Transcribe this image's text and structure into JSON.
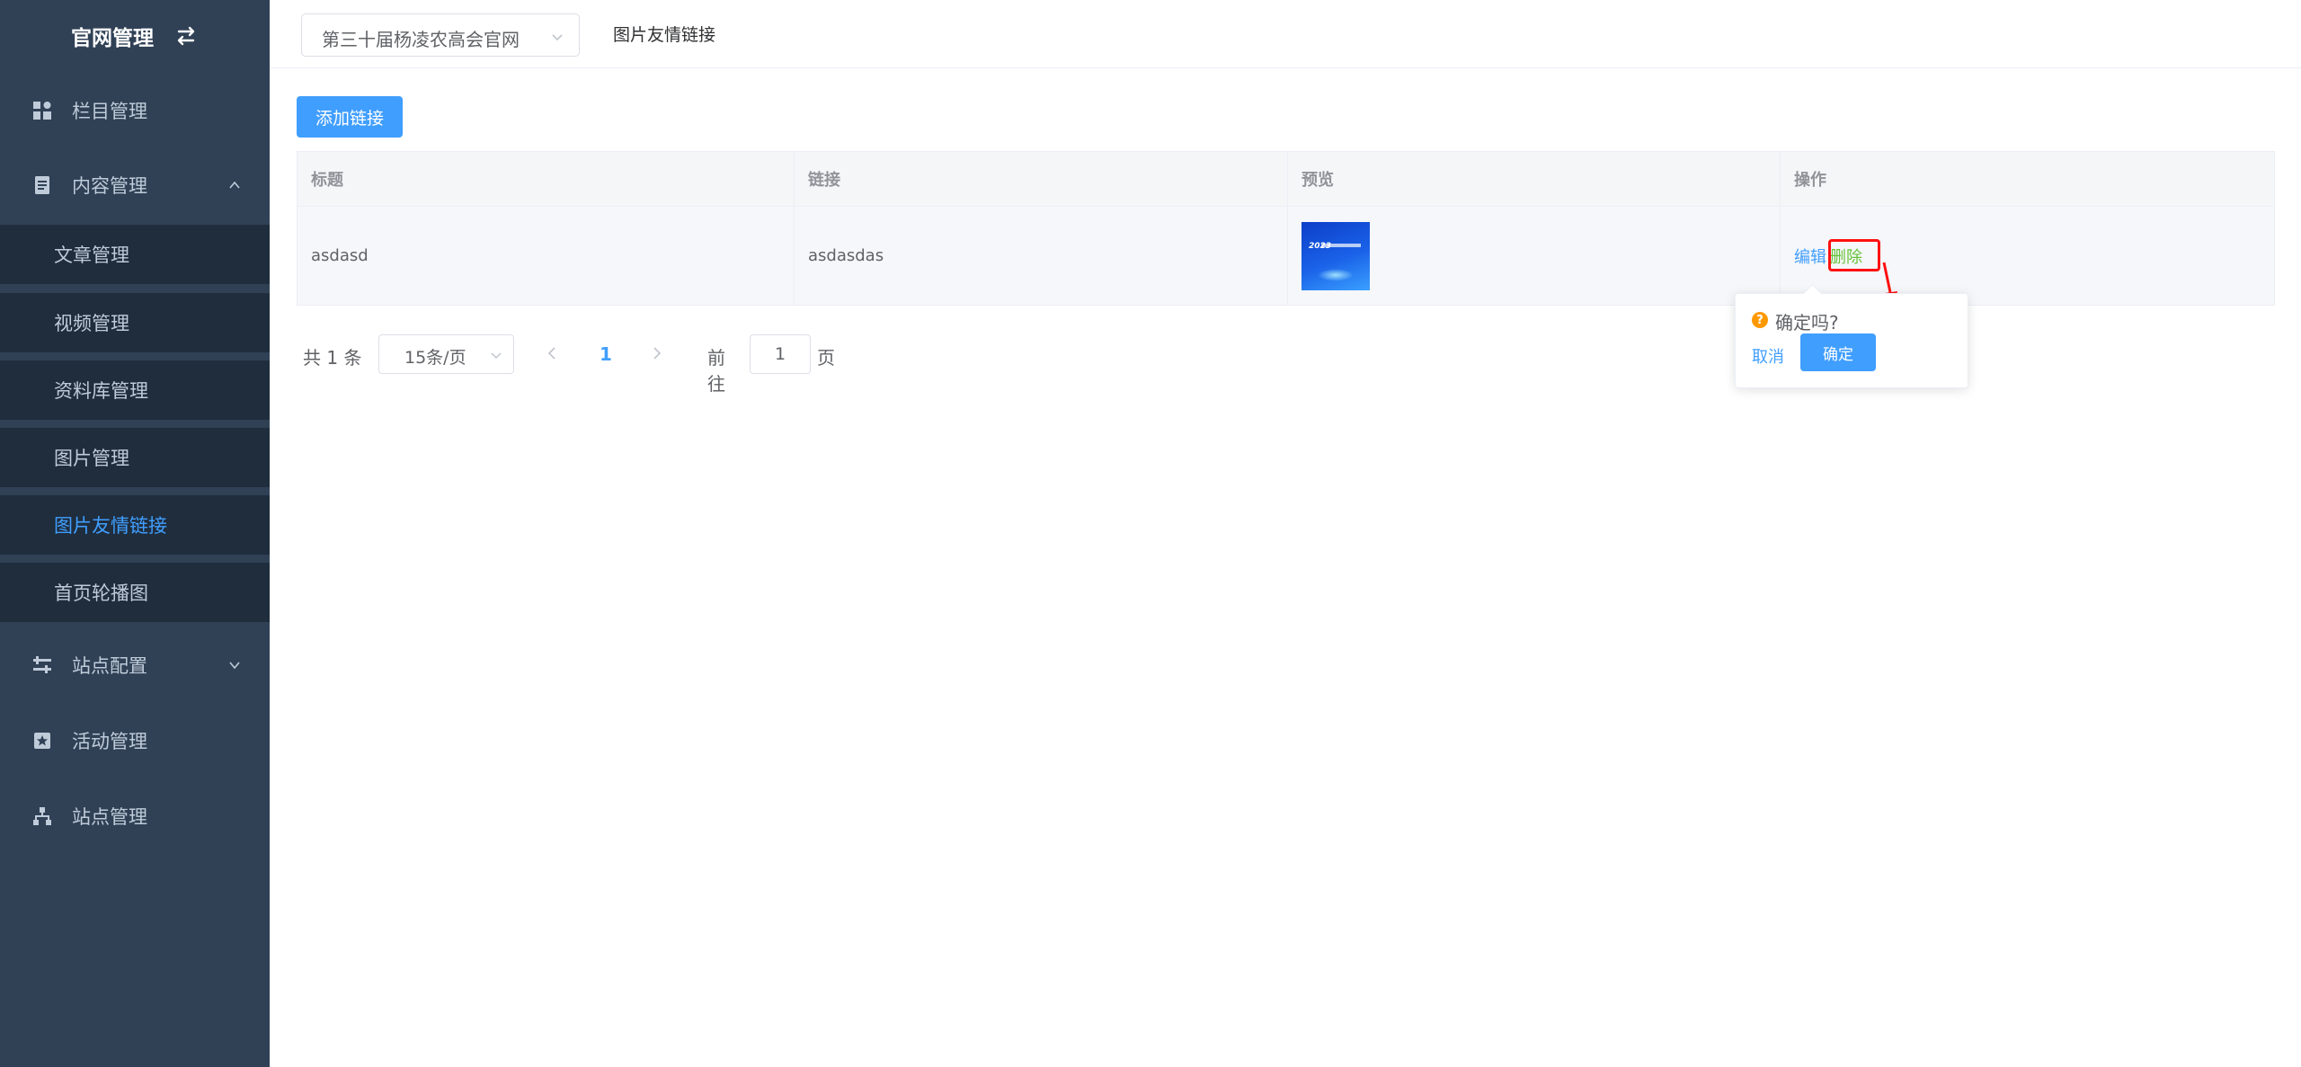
{
  "sidebar": {
    "title": "官网管理",
    "menu": [
      {
        "label": "栏目管理"
      },
      {
        "label": "内容管理"
      },
      {
        "label": "站点配置"
      },
      {
        "label": "活动管理"
      },
      {
        "label": "站点管理"
      }
    ],
    "content_sub": [
      {
        "label": "文章管理"
      },
      {
        "label": "视频管理"
      },
      {
        "label": "资料库管理"
      },
      {
        "label": "图片管理"
      },
      {
        "label": "图片友情链接"
      },
      {
        "label": "首页轮播图"
      }
    ]
  },
  "header": {
    "site_select": "第三十届杨凌农高会官网",
    "breadcrumb": "图片友情链接"
  },
  "toolbar": {
    "add_label": "添加链接"
  },
  "table": {
    "columns": [
      "标题",
      "链接",
      "预览",
      "操作"
    ],
    "rows": [
      {
        "title": "asdasd",
        "link": "asdasdas",
        "edit": "编辑",
        "delete": "删除"
      }
    ]
  },
  "popconfirm": {
    "message": "确定吗?",
    "cancel": "取消",
    "confirm": "确定"
  },
  "pagination": {
    "total": "共 1 条",
    "page_size": "15条/页",
    "current": "1",
    "goto_label": "前往",
    "goto_value": "1",
    "page_unit": "页"
  },
  "colors": {
    "sidebar_bg": "#304156",
    "accent": "#409eff",
    "delete_link": "#67c23a",
    "warning": "#ff9900"
  }
}
